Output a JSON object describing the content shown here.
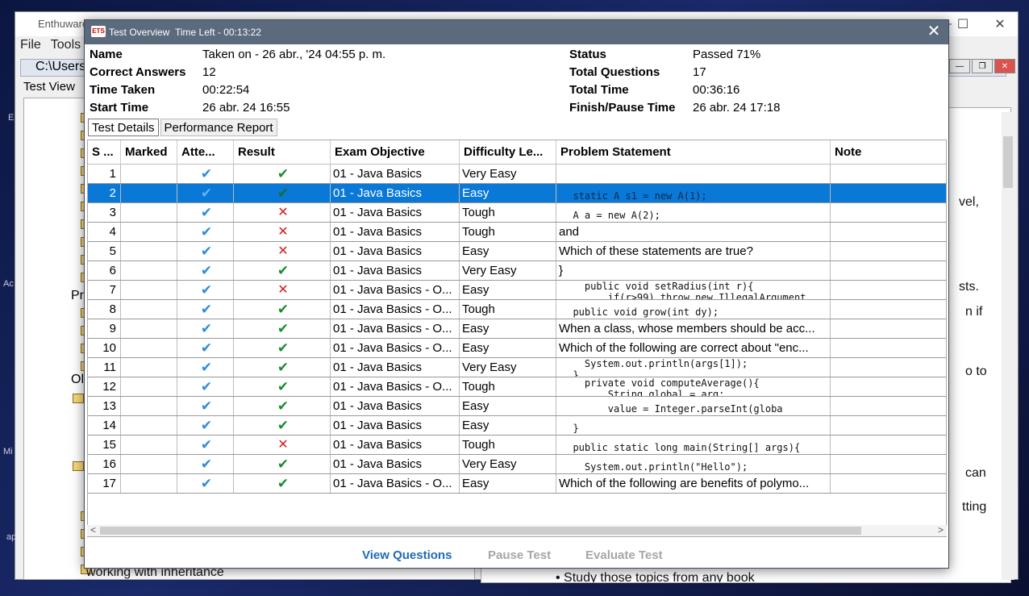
{
  "background": {
    "app_name": "Enthuware",
    "menu": [
      "File",
      "Tools"
    ],
    "path": "C:\\Users\\",
    "tab": "Test View",
    "tree_labels": [
      "Pr",
      "Ol"
    ],
    "right_fragments": [
      "vel,",
      "sts.",
      "n if",
      "o to",
      "can",
      "tting"
    ],
    "bottom_text": "working with inheritance",
    "right_bottom_text": "• Study those topics from any book",
    "desktop_fragments": [
      "Ac",
      "Mi",
      "ap",
      "E"
    ]
  },
  "dialog": {
    "title": "Test Overview",
    "time_left": "Time Left - 00:13:22",
    "summary": {
      "name_label": "Name",
      "name_value": "Taken on - 26 abr., '24 04:55 p. m.",
      "correct_label": "Correct Answers",
      "correct_value": "12",
      "time_taken_label": "Time Taken",
      "time_taken_value": "00:22:54",
      "start_label": "Start Time",
      "start_value": "26 abr. 24 16:55",
      "status_label": "Status",
      "status_value": "Passed 71%",
      "total_q_label": "Total Questions",
      "total_q_value": "17",
      "total_time_label": "Total Time",
      "total_time_value": "00:36:16",
      "finish_label": "Finish/Pause Time",
      "finish_value": "26 abr. 24 17:18"
    },
    "tabs": [
      "Test Details",
      "Performance Report"
    ],
    "columns": [
      "S ...",
      "Marked",
      "Atte...",
      "Result",
      "Exam Objective",
      "Difficulty Le...",
      "Problem Statement",
      "Note"
    ],
    "rows": [
      {
        "n": "1",
        "result": "correct",
        "objective": "01 - Java Basics",
        "difficulty": "Very Easy",
        "statement": "",
        "code": []
      },
      {
        "n": "2",
        "result": "correct",
        "objective": "01 - Java Basics",
        "difficulty": "Easy",
        "statement": "",
        "code": [
          "  static A s1 = new A(1);"
        ],
        "selected": true
      },
      {
        "n": "3",
        "result": "wrong",
        "objective": "01 - Java Basics",
        "difficulty": "Tough",
        "statement": "",
        "code": [
          "  A a = new A(2);"
        ]
      },
      {
        "n": "4",
        "result": "wrong",
        "objective": "01 - Java Basics",
        "difficulty": "Tough",
        "statement": "and",
        "code": []
      },
      {
        "n": "5",
        "result": "wrong",
        "objective": "01 - Java Basics",
        "difficulty": "Easy",
        "statement": "Which of these statements are true?",
        "code": []
      },
      {
        "n": "6",
        "result": "correct",
        "objective": "01 - Java Basics",
        "difficulty": "Very Easy",
        "statement": "}",
        "code": []
      },
      {
        "n": "7",
        "result": "wrong",
        "objective": "01 - Java Basics - O...",
        "difficulty": "Easy",
        "statement": "",
        "code": [
          "    public void setRadius(int r){",
          "        if(r>99) throw new IllegalArgument"
        ]
      },
      {
        "n": "8",
        "result": "correct",
        "objective": "01 - Java Basics - O...",
        "difficulty": "Tough",
        "statement": "",
        "code": [
          "  public void grow(int dy);"
        ]
      },
      {
        "n": "9",
        "result": "correct",
        "objective": "01 - Java Basics - O...",
        "difficulty": "Easy",
        "statement": "When a class, whose members should be acc...",
        "code": []
      },
      {
        "n": "10",
        "result": "correct",
        "objective": "01 - Java Basics - O...",
        "difficulty": "Easy",
        "statement": "Which of the following are correct about \"enc...",
        "code": []
      },
      {
        "n": "11",
        "result": "correct",
        "objective": "01 - Java Basics",
        "difficulty": "Very Easy",
        "statement": "",
        "code": [
          "    System.out.println(args[1]);",
          "  }"
        ]
      },
      {
        "n": "12",
        "result": "correct",
        "objective": "01 - Java Basics - O...",
        "difficulty": "Tough",
        "statement": "",
        "code": [
          "    private void computeAverage(){",
          "        String global = arg;"
        ]
      },
      {
        "n": "13",
        "result": "correct",
        "objective": "01 - Java Basics",
        "difficulty": "Easy",
        "statement": "",
        "code": [
          "        value = Integer.parseInt(globa"
        ]
      },
      {
        "n": "14",
        "result": "correct",
        "objective": "01 - Java Basics",
        "difficulty": "Easy",
        "statement": "",
        "code": [
          "  }"
        ]
      },
      {
        "n": "15",
        "result": "wrong",
        "objective": "01 - Java Basics",
        "difficulty": "Tough",
        "statement": "",
        "code": [
          "  public static long main(String[] args){"
        ]
      },
      {
        "n": "16",
        "result": "correct",
        "objective": "01 - Java Basics",
        "difficulty": "Very Easy",
        "statement": "",
        "code": [
          "    System.out.println(\"Hello\");"
        ]
      },
      {
        "n": "17",
        "result": "correct",
        "objective": "01 - Java Basics - O...",
        "difficulty": "Easy",
        "statement": "Which of the following are benefits of polymo...",
        "code": []
      }
    ],
    "buttons": {
      "view": "View Questions",
      "pause": "Pause Test",
      "evaluate": "Evaluate Test"
    },
    "icons": {
      "attempted": "blue-check-icon",
      "correct": "green-check-icon",
      "wrong": "red-cross-icon"
    },
    "colors": {
      "titlebar": "#5c6a7e",
      "selection": "#0a78d7",
      "link": "#1f6bb7"
    }
  }
}
